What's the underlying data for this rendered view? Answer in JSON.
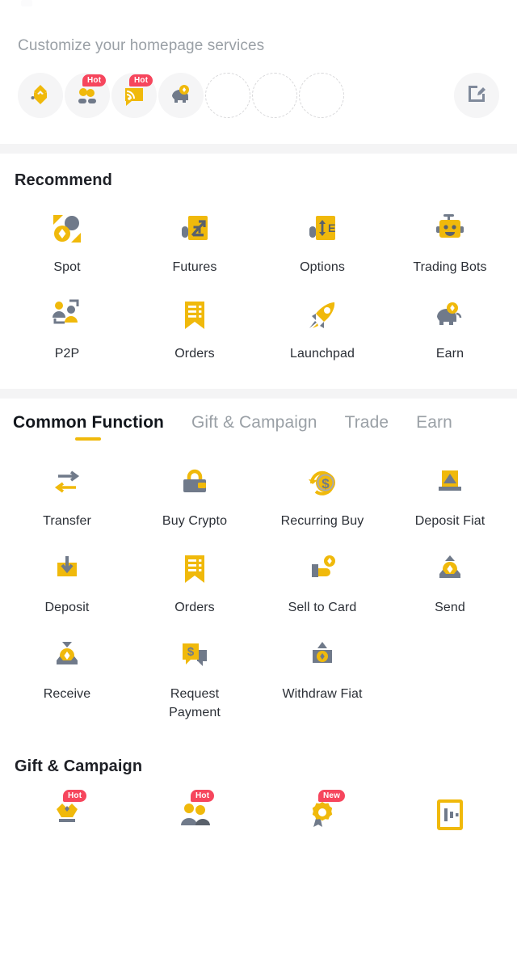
{
  "customize": {
    "title": "Customize your homepage services",
    "chips": [
      {
        "icon": "binance-logo-icon",
        "badge": null
      },
      {
        "icon": "rewards-hub-icon",
        "badge": "Hot"
      },
      {
        "icon": "referral-megaphone-icon",
        "badge": "Hot"
      },
      {
        "icon": "piggy-bank-earn-icon",
        "badge": null
      },
      {
        "icon": "empty-slot-icon",
        "badge": null
      },
      {
        "icon": "empty-slot-icon",
        "badge": null
      },
      {
        "icon": "empty-slot-icon",
        "badge": null
      }
    ],
    "edit_label": "edit-services-icon"
  },
  "recommend": {
    "title": "Recommend",
    "items": [
      {
        "label": "Spot",
        "icon": "spot-icon"
      },
      {
        "label": "Futures",
        "icon": "futures-icon"
      },
      {
        "label": "Options",
        "icon": "options-icon"
      },
      {
        "label": "Trading Bots",
        "icon": "trading-bots-icon"
      },
      {
        "label": "P2P",
        "icon": "p2p-icon"
      },
      {
        "label": "Orders",
        "icon": "orders-icon"
      },
      {
        "label": "Launchpad",
        "icon": "launchpad-icon"
      },
      {
        "label": "Earn",
        "icon": "earn-icon"
      }
    ]
  },
  "tabs": [
    {
      "label": "Common Function",
      "active": true
    },
    {
      "label": "Gift & Campaign",
      "active": false
    },
    {
      "label": "Trade",
      "active": false
    },
    {
      "label": "Earn",
      "active": false
    }
  ],
  "common_function": {
    "items": [
      {
        "label": "Transfer",
        "icon": "transfer-icon"
      },
      {
        "label": "Buy Crypto",
        "icon": "buy-crypto-icon"
      },
      {
        "label": "Recurring Buy",
        "icon": "recurring-buy-icon"
      },
      {
        "label": "Deposit Fiat",
        "icon": "deposit-fiat-icon"
      },
      {
        "label": "Deposit",
        "icon": "deposit-icon"
      },
      {
        "label": "Orders",
        "icon": "orders-icon"
      },
      {
        "label": "Sell to Card",
        "icon": "sell-to-card-icon"
      },
      {
        "label": "Send",
        "icon": "send-icon"
      },
      {
        "label": "Receive",
        "icon": "receive-icon"
      },
      {
        "label": "Request\nPayment",
        "icon": "request-payment-icon"
      },
      {
        "label": "Withdraw Fiat",
        "icon": "withdraw-fiat-icon"
      }
    ]
  },
  "gift_campaign": {
    "title": "Gift & Campaign",
    "items": [
      {
        "label": "",
        "icon": "crypto-box-icon",
        "badge": "Hot"
      },
      {
        "label": "",
        "icon": "referral-people-icon",
        "badge": "Hot"
      },
      {
        "label": "",
        "icon": "rewards-medal-icon",
        "badge": "New"
      },
      {
        "label": "",
        "icon": "voucher-card-icon",
        "badge": null
      }
    ]
  },
  "colors": {
    "accent": "#f0b90b",
    "gray": "#707a8a",
    "badge": "#f6465d",
    "text": "#1e2026",
    "muted": "#9aa0a6",
    "divider": "#f4f4f5"
  }
}
